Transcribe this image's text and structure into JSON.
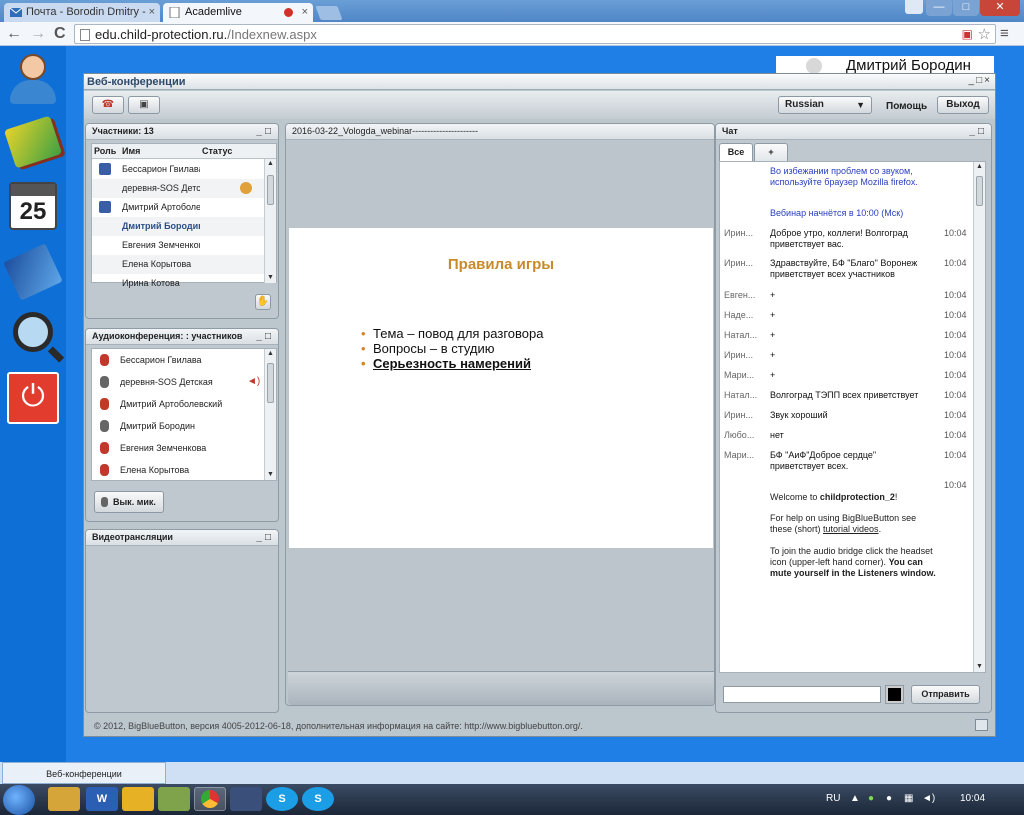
{
  "browser": {
    "tabs": [
      {
        "title": "Почта - Borodin Dmitry -",
        "close": "×"
      },
      {
        "title": "Academlive",
        "close": "×"
      }
    ],
    "url": "edu.child-protection.ru./Indexnew.aspx",
    "url_host": "edu.child-protection.ru.",
    "url_path": "/Indexnew.aspx",
    "nav": {
      "back": "←",
      "forward": "→",
      "reload": "C"
    },
    "star": "☆",
    "menu": "≡",
    "window": {
      "min": "—",
      "max": "□",
      "close": "✕"
    }
  },
  "user_banner": "Дмитрий Бородин",
  "app": {
    "title": "Веб-конференции",
    "title_controls": "_□×",
    "language": "Russian",
    "help": "Помощь",
    "exit": "Выход"
  },
  "participants": {
    "title": "Участники: 13",
    "columns": [
      "Роль",
      "Имя",
      "Статус"
    ],
    "rows": [
      {
        "name": "Бессарион Гвилава",
        "moderator": true,
        "status": false,
        "me": false
      },
      {
        "name": "деревня-SOS Детская",
        "moderator": false,
        "status": true,
        "me": false
      },
      {
        "name": "Дмитрий Артоболевский",
        "moderator": true,
        "status": false,
        "me": false
      },
      {
        "name": "Дмитрий Бородин",
        "moderator": false,
        "status": false,
        "me": true
      },
      {
        "name": "Евгения Земченкова",
        "moderator": false,
        "status": false,
        "me": false
      },
      {
        "name": "Елена Корытова",
        "moderator": false,
        "status": false,
        "me": false
      },
      {
        "name": "Ирина Котова",
        "moderator": false,
        "status": false,
        "me": false
      }
    ]
  },
  "audio": {
    "title": "Аудиоконференция: : участников",
    "rows": [
      {
        "name": "Бессарион Гвилава",
        "muted": true,
        "talking": false
      },
      {
        "name": "деревня-SOS Детская",
        "muted": false,
        "talking": true
      },
      {
        "name": "Дмитрий Артоболевский",
        "muted": true,
        "talking": false
      },
      {
        "name": "Дмитрий Бородин",
        "muted": false,
        "talking": false
      },
      {
        "name": "Евгения Земченкова",
        "muted": true,
        "talking": false
      },
      {
        "name": "Елена Корытова",
        "muted": true,
        "talking": false
      }
    ],
    "mute_button": "Вык. мик."
  },
  "video": {
    "title": "Видеотрансляции"
  },
  "presentation": {
    "title": "2016-03-22_Vologda_webinar----------------------",
    "slide_title": "Правила игры",
    "bullets": [
      "Тема – повод для разговора",
      "Вопросы – в студию",
      "Серьезность намерений"
    ]
  },
  "chat": {
    "title": "Чат",
    "tabs": [
      "Все",
      "+"
    ],
    "messages": [
      {
        "who": "",
        "text": "Во избежании проблем со звуком, используйте браузер Mozilla firefox.",
        "time": "",
        "sys": true
      },
      {
        "who": "",
        "text": "Вебинар начнётся в 10:00 (Мск)",
        "time": "",
        "sys": true
      },
      {
        "who": "Ирин...",
        "text": "Доброе утро, коллеги! Волгоград приветствует вас.",
        "time": "10:04",
        "sys": false
      },
      {
        "who": "Ирин...",
        "text": "Здравствуйте, БФ \"Благо\" Воронеж приветствует всех участников",
        "time": "10:04",
        "sys": false
      },
      {
        "who": "Евген...",
        "text": "+",
        "time": "10:04",
        "sys": false
      },
      {
        "who": "Наде...",
        "text": "+",
        "time": "10:04",
        "sys": false
      },
      {
        "who": "Натал...",
        "text": "+",
        "time": "10:04",
        "sys": false
      },
      {
        "who": "Ирин...",
        "text": " +",
        "time": "10:04",
        "sys": false
      },
      {
        "who": "Мари...",
        "text": "+",
        "time": "10:04",
        "sys": false
      },
      {
        "who": "Натал...",
        "text": "Волгоград ТЭПП всех приветствует",
        "time": "10:04",
        "sys": false
      },
      {
        "who": "Ирин...",
        "text": "Звук хороший",
        "time": "10:04",
        "sys": false
      },
      {
        "who": "Любо...",
        "text": "нет",
        "time": "10:04",
        "sys": false
      },
      {
        "who": "Мари...",
        "text": "БФ \"АиФ\"Доброе сердце\" приветствует всех.",
        "time": "10:04",
        "sys": false
      },
      {
        "who": "",
        "text": "",
        "time": "10:04",
        "sys": false
      }
    ],
    "welcome_prefix": "Welcome to ",
    "welcome_room": "childprotection_2",
    "welcome_suffix": "!",
    "help_text": "For help on using BigBlueButton see these (short) ",
    "help_link": "tutorial videos",
    "help_end": ".",
    "audio_text": "To join the audio bridge click the headset icon (upper-left hand corner). ",
    "audio_bold": "You can mute yourself in the Listeners window.",
    "send": "Отправить",
    "input_value": ""
  },
  "footer": "© 2012, BigBlueButton, версия 4005-2012-06-18, дополнительная информация на сайте: http://www.bigbluebutton.org/.",
  "bottom_tab": "Веб-конференции",
  "taskbar": {
    "lang": "RU",
    "time": "10:04",
    "apps": [
      "W",
      "S",
      "S"
    ]
  },
  "sidebar_calendar": "25"
}
